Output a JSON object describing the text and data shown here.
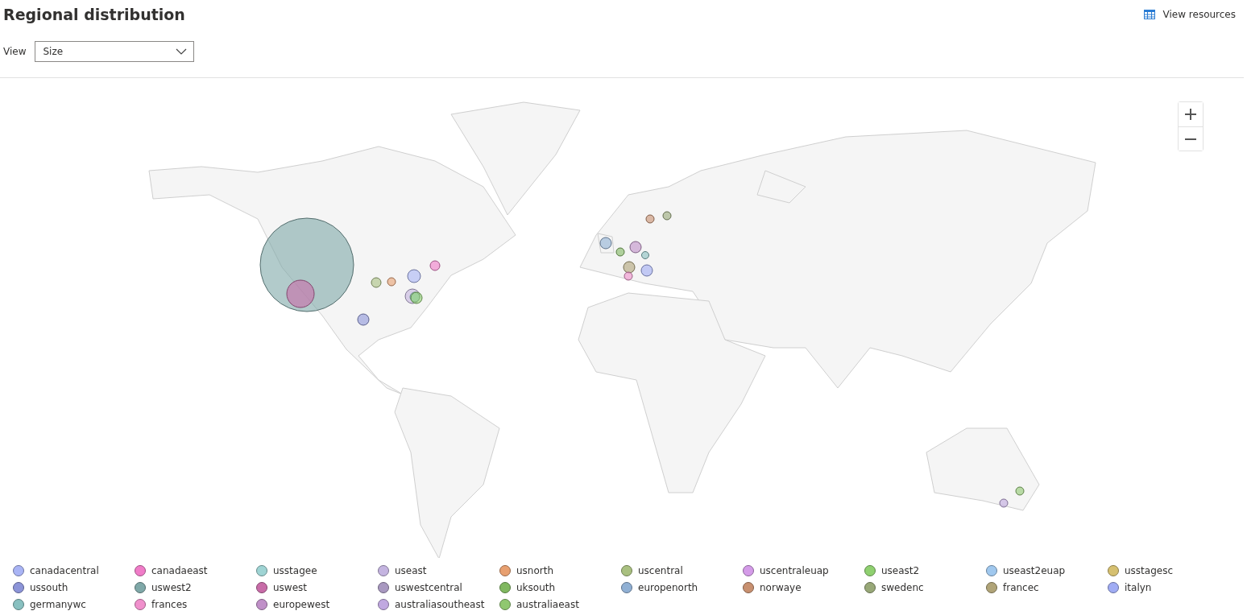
{
  "header": {
    "title": "Regional distribution",
    "view_resources": "View resources"
  },
  "view": {
    "label": "View",
    "value": "Size"
  },
  "legend": [
    {
      "name": "canadacentral",
      "color": "#a9b4f5"
    },
    {
      "name": "canadaeast",
      "color": "#f07cc8"
    },
    {
      "name": "usstagee",
      "color": "#9fd4d4"
    },
    {
      "name": "useast",
      "color": "#c4b4e0"
    },
    {
      "name": "usnorth",
      "color": "#e8a070"
    },
    {
      "name": "uscentral",
      "color": "#a9c080"
    },
    {
      "name": "uscentraleuap",
      "color": "#d49be8"
    },
    {
      "name": "useast2",
      "color": "#8fd070"
    },
    {
      "name": "useast2euap",
      "color": "#a0c8ee"
    },
    {
      "name": "usstagesc",
      "color": "#d6c070"
    },
    {
      "name": "ussouth",
      "color": "#8c94d8"
    },
    {
      "name": "uswest2",
      "color": "#7fa8a8"
    },
    {
      "name": "uswest",
      "color": "#c86ca8"
    },
    {
      "name": "uswestcentral",
      "color": "#a898c0"
    },
    {
      "name": "uksouth",
      "color": "#80b860"
    },
    {
      "name": "europenorth",
      "color": "#90b0d4"
    },
    {
      "name": "norwaye",
      "color": "#c89070"
    },
    {
      "name": "swedenc",
      "color": "#98a878"
    },
    {
      "name": "francec",
      "color": "#b0a478"
    },
    {
      "name": "italyn",
      "color": "#a0acf4"
    },
    {
      "name": "germanywc",
      "color": "#88c0c0"
    },
    {
      "name": "frances",
      "color": "#f090cc"
    },
    {
      "name": "europewest",
      "color": "#c090c8"
    },
    {
      "name": "australiasoutheast",
      "color": "#c0a8e0"
    },
    {
      "name": "australiaeast",
      "color": "#90c870"
    }
  ]
}
